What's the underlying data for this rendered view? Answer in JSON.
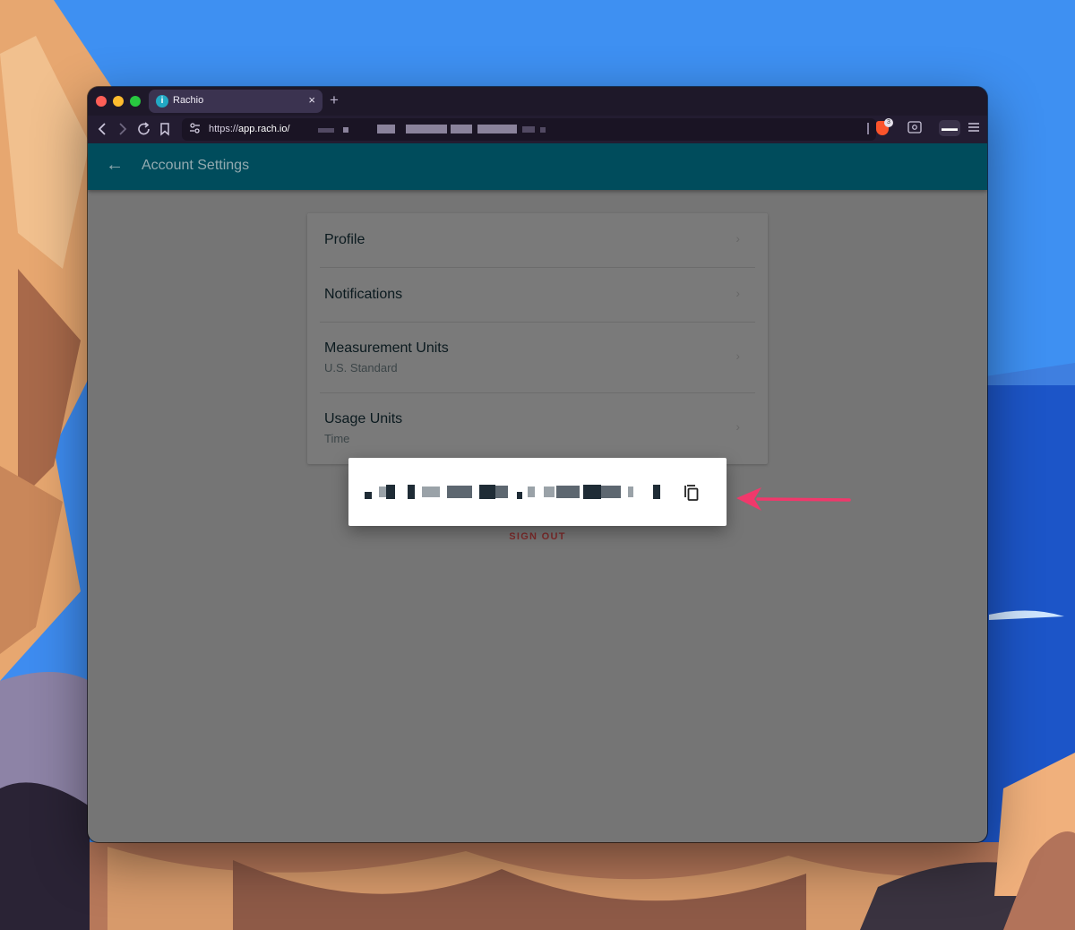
{
  "browser": {
    "tab_title": "Rachio",
    "tab_close": "×",
    "new_tab": "+",
    "url_scheme": "https://",
    "url_host": "app.rach.io/",
    "brave_badge": "3"
  },
  "app": {
    "header_title": "Account Settings",
    "back_icon": "←",
    "chevron": "›"
  },
  "settings": {
    "items": [
      {
        "label": "Profile",
        "sub": ""
      },
      {
        "label": "Notifications",
        "sub": ""
      },
      {
        "label": "Measurement Units",
        "sub": "U.S. Standard"
      },
      {
        "label": "Usage Units",
        "sub": "Time"
      }
    ]
  },
  "sign_out": "SIGN OUT",
  "popup": {
    "copy_icon": "copy-icon"
  },
  "colors": {
    "appbar": "#004c5c",
    "overlay": "#757575",
    "arrow": "#f0386b",
    "sign_out": "#7d2b2b"
  }
}
